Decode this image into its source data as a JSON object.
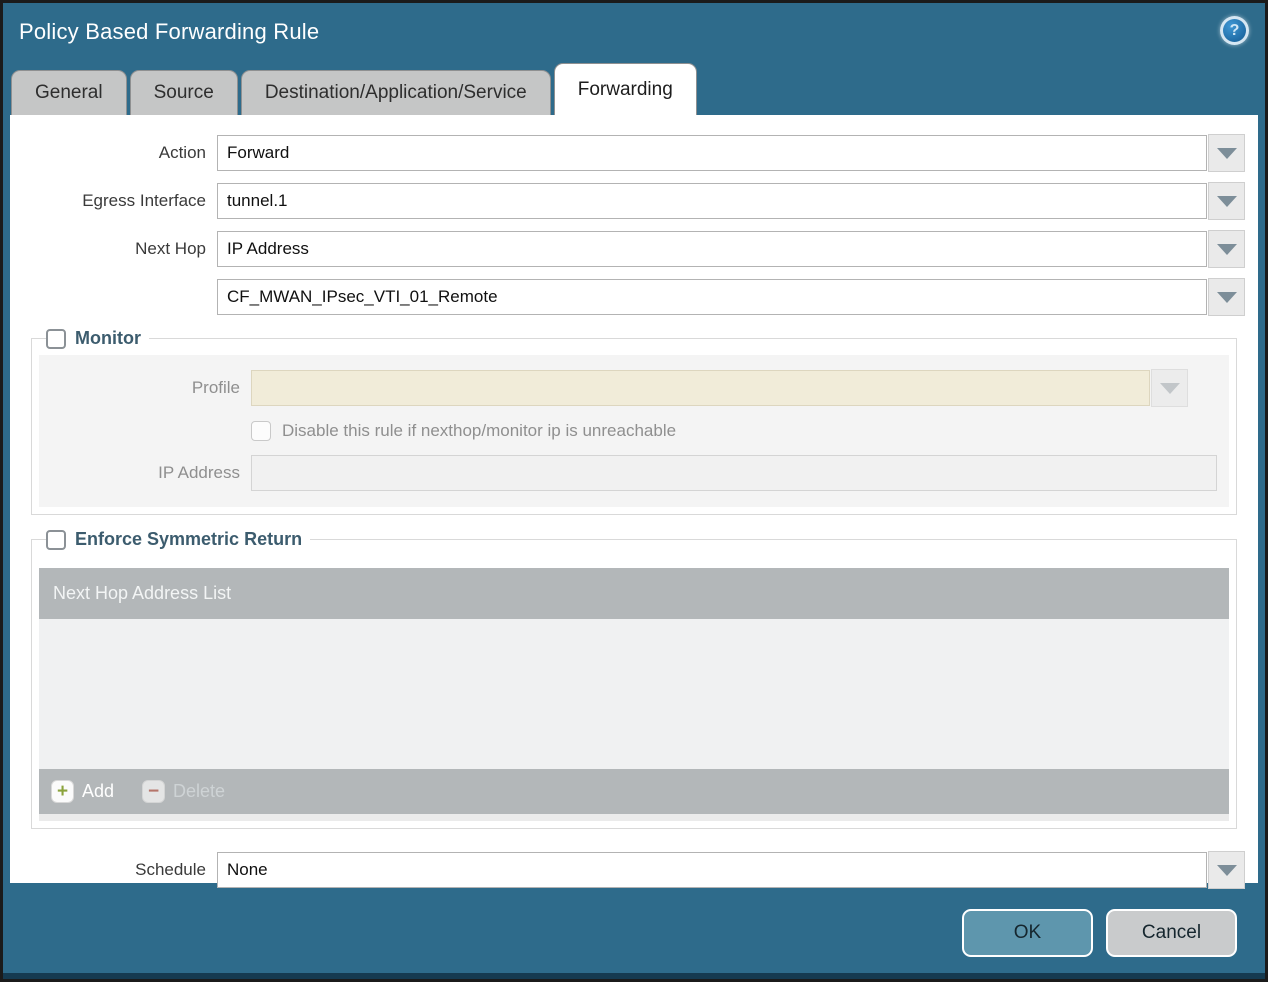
{
  "dialog": {
    "title": "Policy Based Forwarding Rule"
  },
  "help": {
    "glyph": "?"
  },
  "tabs": [
    {
      "label": "General",
      "active": false
    },
    {
      "label": "Source",
      "active": false
    },
    {
      "label": "Destination/Application/Service",
      "active": false
    },
    {
      "label": "Forwarding",
      "active": true
    }
  ],
  "form": {
    "action": {
      "label": "Action",
      "value": "Forward"
    },
    "egress_interface": {
      "label": "Egress Interface",
      "value": "tunnel.1"
    },
    "next_hop": {
      "label": "Next Hop",
      "value": "IP Address"
    },
    "next_hop_address": {
      "value": "CF_MWAN_IPsec_VTI_01_Remote"
    },
    "schedule": {
      "label": "Schedule",
      "value": "None"
    }
  },
  "monitor": {
    "title": "Monitor",
    "checked": false,
    "profile": {
      "label": "Profile",
      "value": ""
    },
    "disable_checkbox": {
      "label": "Disable this rule if nexthop/monitor ip is unreachable",
      "checked": false
    },
    "ip_address": {
      "label": "IP Address",
      "value": ""
    }
  },
  "symmetric_return": {
    "title": "Enforce Symmetric Return",
    "checked": false,
    "table": {
      "header": "Next Hop Address List",
      "rows": []
    },
    "add_label": "Add",
    "add_glyph": "+",
    "delete_label": "Delete",
    "delete_glyph": "−"
  },
  "buttons": {
    "ok": "OK",
    "cancel": "Cancel"
  },
  "colors": {
    "chrome_teal": "#2e6b8b",
    "active_tab_bg": "#ffffff",
    "inactive_tab_bg": "#c5c6c6",
    "section_title": "#3c5c6e",
    "table_bar": "#b3b7b9",
    "profile_field_bg": "#f1ecd9",
    "ok_button_bg": "#5e96ad",
    "cancel_button_bg": "#c9cbcc",
    "add_icon_green": "#8ba33c",
    "delete_icon_red": "#b5756a"
  }
}
